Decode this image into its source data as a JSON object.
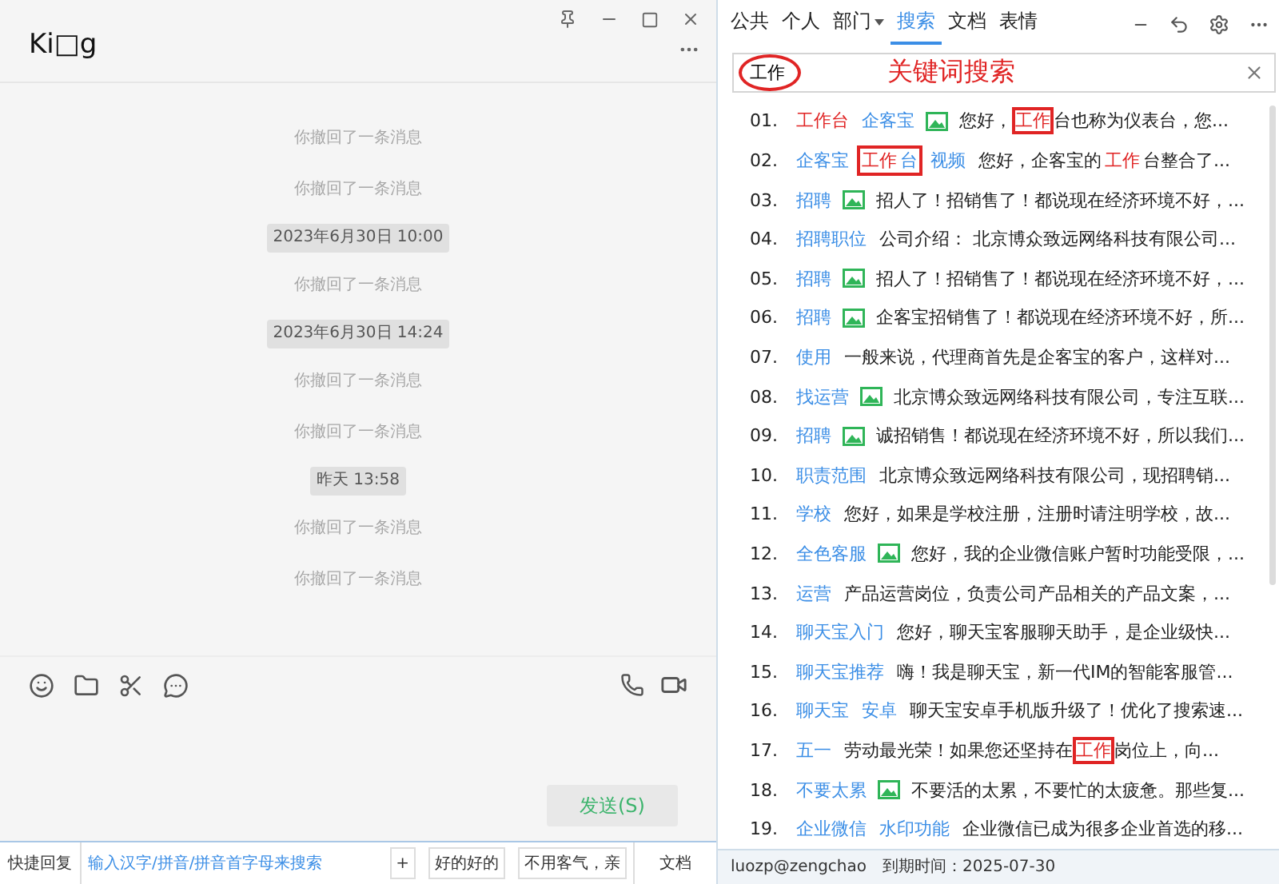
{
  "chat": {
    "title": "Ki□g",
    "messages": [
      {
        "kind": "recall",
        "text": "你撤回了一条消息"
      },
      {
        "kind": "recall",
        "text": "你撤回了一条消息"
      },
      {
        "kind": "time",
        "text": "2023年6月30日 10:00"
      },
      {
        "kind": "recall",
        "text": "你撤回了一条消息"
      },
      {
        "kind": "time",
        "text": "2023年6月30日 14:24"
      },
      {
        "kind": "recall",
        "text": "你撤回了一条消息"
      },
      {
        "kind": "recall",
        "text": "你撤回了一条消息"
      },
      {
        "kind": "time",
        "text": "昨天 13:58"
      },
      {
        "kind": "recall",
        "text": "你撤回了一条消息"
      },
      {
        "kind": "recall",
        "text": "你撤回了一条消息"
      }
    ],
    "send_button": "发送(S)"
  },
  "quick_bar": {
    "label": "快捷回复",
    "placeholder": "输入汉字/拼音/拼音首字母来搜索",
    "add": "+",
    "replies": [
      "好的好的",
      "不用客气，亲"
    ],
    "doc_button": "文档"
  },
  "tabs": [
    {
      "label": "公共",
      "selected": false,
      "dropdown": false
    },
    {
      "label": "个人",
      "selected": false,
      "dropdown": false
    },
    {
      "label": "部门",
      "selected": false,
      "dropdown": true
    },
    {
      "label": "搜索",
      "selected": true,
      "dropdown": false
    },
    {
      "label": "文档",
      "selected": false,
      "dropdown": false
    },
    {
      "label": "表情",
      "selected": false,
      "dropdown": false
    }
  ],
  "search": {
    "value": "工作",
    "circled": true,
    "annotation": "关键词搜索"
  },
  "results": [
    {
      "number": "01.",
      "tags": [
        {
          "boxed": false,
          "parts": [
            {
              "text": "工作台",
              "match": true
            }
          ]
        },
        {
          "boxed": false,
          "parts": [
            {
              "text": "企客宝",
              "match": false
            }
          ]
        }
      ],
      "image": true,
      "text": [
        {
          "text": "您好，",
          "match": false,
          "boxed": false
        },
        {
          "text": "工作",
          "match": true,
          "boxed": true
        },
        {
          "text": "台也称为仪表台，您...",
          "match": false,
          "boxed": false
        }
      ]
    },
    {
      "number": "02.",
      "tags": [
        {
          "boxed": false,
          "parts": [
            {
              "text": "企客宝",
              "match": false
            }
          ]
        },
        {
          "boxed": true,
          "parts": [
            {
              "text": "工作",
              "match": true
            },
            {
              "text": "台",
              "match": false
            }
          ]
        },
        {
          "boxed": false,
          "parts": [
            {
              "text": "视频",
              "match": false
            }
          ]
        }
      ],
      "image": false,
      "text": [
        {
          "text": "您好，企客宝的",
          "match": false,
          "boxed": false
        },
        {
          "text": "工作",
          "match": true,
          "boxed": false
        },
        {
          "text": "台整合了...",
          "match": false,
          "boxed": false
        }
      ]
    },
    {
      "number": "03.",
      "tags": [
        {
          "boxed": false,
          "parts": [
            {
              "text": "招聘",
              "match": false
            }
          ]
        }
      ],
      "image": true,
      "text": [
        {
          "text": "招人了！招销售了！都说现在经济环境不好，...",
          "match": false,
          "boxed": false
        }
      ]
    },
    {
      "number": "04.",
      "tags": [
        {
          "boxed": false,
          "parts": [
            {
              "text": "招聘职位",
              "match": false
            }
          ]
        }
      ],
      "image": false,
      "text": [
        {
          "text": "公司介绍： 北京博众致远网络科技有限公司...",
          "match": false,
          "boxed": false
        }
      ]
    },
    {
      "number": "05.",
      "tags": [
        {
          "boxed": false,
          "parts": [
            {
              "text": "招聘",
              "match": false
            }
          ]
        }
      ],
      "image": true,
      "text": [
        {
          "text": "招人了！招销售了！都说现在经济环境不好，...",
          "match": false,
          "boxed": false
        }
      ]
    },
    {
      "number": "06.",
      "tags": [
        {
          "boxed": false,
          "parts": [
            {
              "text": "招聘",
              "match": false
            }
          ]
        }
      ],
      "image": true,
      "text": [
        {
          "text": "企客宝招销售了！都说现在经济环境不好，所...",
          "match": false,
          "boxed": false
        }
      ]
    },
    {
      "number": "07.",
      "tags": [
        {
          "boxed": false,
          "parts": [
            {
              "text": "使用",
              "match": false
            }
          ]
        }
      ],
      "image": false,
      "text": [
        {
          "text": "一般来说，代理商首先是企客宝的客户，这样对...",
          "match": false,
          "boxed": false
        }
      ]
    },
    {
      "number": "08.",
      "tags": [
        {
          "boxed": false,
          "parts": [
            {
              "text": "找运营",
              "match": false
            }
          ]
        }
      ],
      "image": true,
      "text": [
        {
          "text": "北京博众致远网络科技有限公司，专注互联...",
          "match": false,
          "boxed": false
        }
      ]
    },
    {
      "number": "09.",
      "tags": [
        {
          "boxed": false,
          "parts": [
            {
              "text": "招聘",
              "match": false
            }
          ]
        }
      ],
      "image": true,
      "text": [
        {
          "text": "诚招销售！都说现在经济环境不好，所以我们...",
          "match": false,
          "boxed": false
        }
      ]
    },
    {
      "number": "10.",
      "tags": [
        {
          "boxed": false,
          "parts": [
            {
              "text": "职责范围",
              "match": false
            }
          ]
        }
      ],
      "image": false,
      "text": [
        {
          "text": "北京博众致远网络科技有限公司，现招聘销...",
          "match": false,
          "boxed": false
        }
      ]
    },
    {
      "number": "11.",
      "tags": [
        {
          "boxed": false,
          "parts": [
            {
              "text": "学校",
              "match": false
            }
          ]
        }
      ],
      "image": false,
      "text": [
        {
          "text": "您好，如果是学校注册，注册时请注明学校，故...",
          "match": false,
          "boxed": false
        }
      ]
    },
    {
      "number": "12.",
      "tags": [
        {
          "boxed": false,
          "parts": [
            {
              "text": "全色客服",
              "match": false
            }
          ]
        }
      ],
      "image": true,
      "text": [
        {
          "text": "您好，我的企业微信账户暂时功能受限，...",
          "match": false,
          "boxed": false
        }
      ]
    },
    {
      "number": "13.",
      "tags": [
        {
          "boxed": false,
          "parts": [
            {
              "text": "运营",
              "match": false
            }
          ]
        }
      ],
      "image": false,
      "text": [
        {
          "text": "产品运营岗位，负责公司产品相关的产品文案，...",
          "match": false,
          "boxed": false
        }
      ]
    },
    {
      "number": "14.",
      "tags": [
        {
          "boxed": false,
          "parts": [
            {
              "text": "聊天宝入门",
              "match": false
            }
          ]
        }
      ],
      "image": false,
      "text": [
        {
          "text": "您好，聊天宝客服聊天助手，是企业级快...",
          "match": false,
          "boxed": false
        }
      ]
    },
    {
      "number": "15.",
      "tags": [
        {
          "boxed": false,
          "parts": [
            {
              "text": "聊天宝推荐",
              "match": false
            }
          ]
        }
      ],
      "image": false,
      "text": [
        {
          "text": "嗨！我是聊天宝，新一代IM的智能客服管...",
          "match": false,
          "boxed": false
        }
      ]
    },
    {
      "number": "16.",
      "tags": [
        {
          "boxed": false,
          "parts": [
            {
              "text": "聊天宝",
              "match": false
            }
          ]
        },
        {
          "boxed": false,
          "parts": [
            {
              "text": "安卓",
              "match": false
            }
          ]
        }
      ],
      "image": false,
      "text": [
        {
          "text": "聊天宝安卓手机版升级了！优化了搜索速...",
          "match": false,
          "boxed": false
        }
      ]
    },
    {
      "number": "17.",
      "tags": [
        {
          "boxed": false,
          "parts": [
            {
              "text": "五一",
              "match": false
            }
          ]
        }
      ],
      "image": false,
      "text": [
        {
          "text": "劳动最光荣！如果您还坚持在",
          "match": false,
          "boxed": false
        },
        {
          "text": "工作",
          "match": true,
          "boxed": true
        },
        {
          "text": "岗位上，向...",
          "match": false,
          "boxed": false
        }
      ]
    },
    {
      "number": "18.",
      "tags": [
        {
          "boxed": false,
          "parts": [
            {
              "text": "不要太累",
              "match": false
            }
          ]
        }
      ],
      "image": true,
      "text": [
        {
          "text": "不要活的太累，不要忙的太疲惫。那些复...",
          "match": false,
          "boxed": false
        }
      ]
    },
    {
      "number": "19.",
      "tags": [
        {
          "boxed": false,
          "parts": [
            {
              "text": "企业微信",
              "match": false
            }
          ]
        },
        {
          "boxed": false,
          "parts": [
            {
              "text": "水印功能",
              "match": false
            }
          ]
        }
      ],
      "image": false,
      "text": [
        {
          "text": "企业微信已成为很多企业首选的移...",
          "match": false,
          "boxed": false
        }
      ]
    }
  ],
  "status_bar": {
    "user": "luozp@zengchao",
    "expiry": "到期时间：2025-07-30"
  }
}
